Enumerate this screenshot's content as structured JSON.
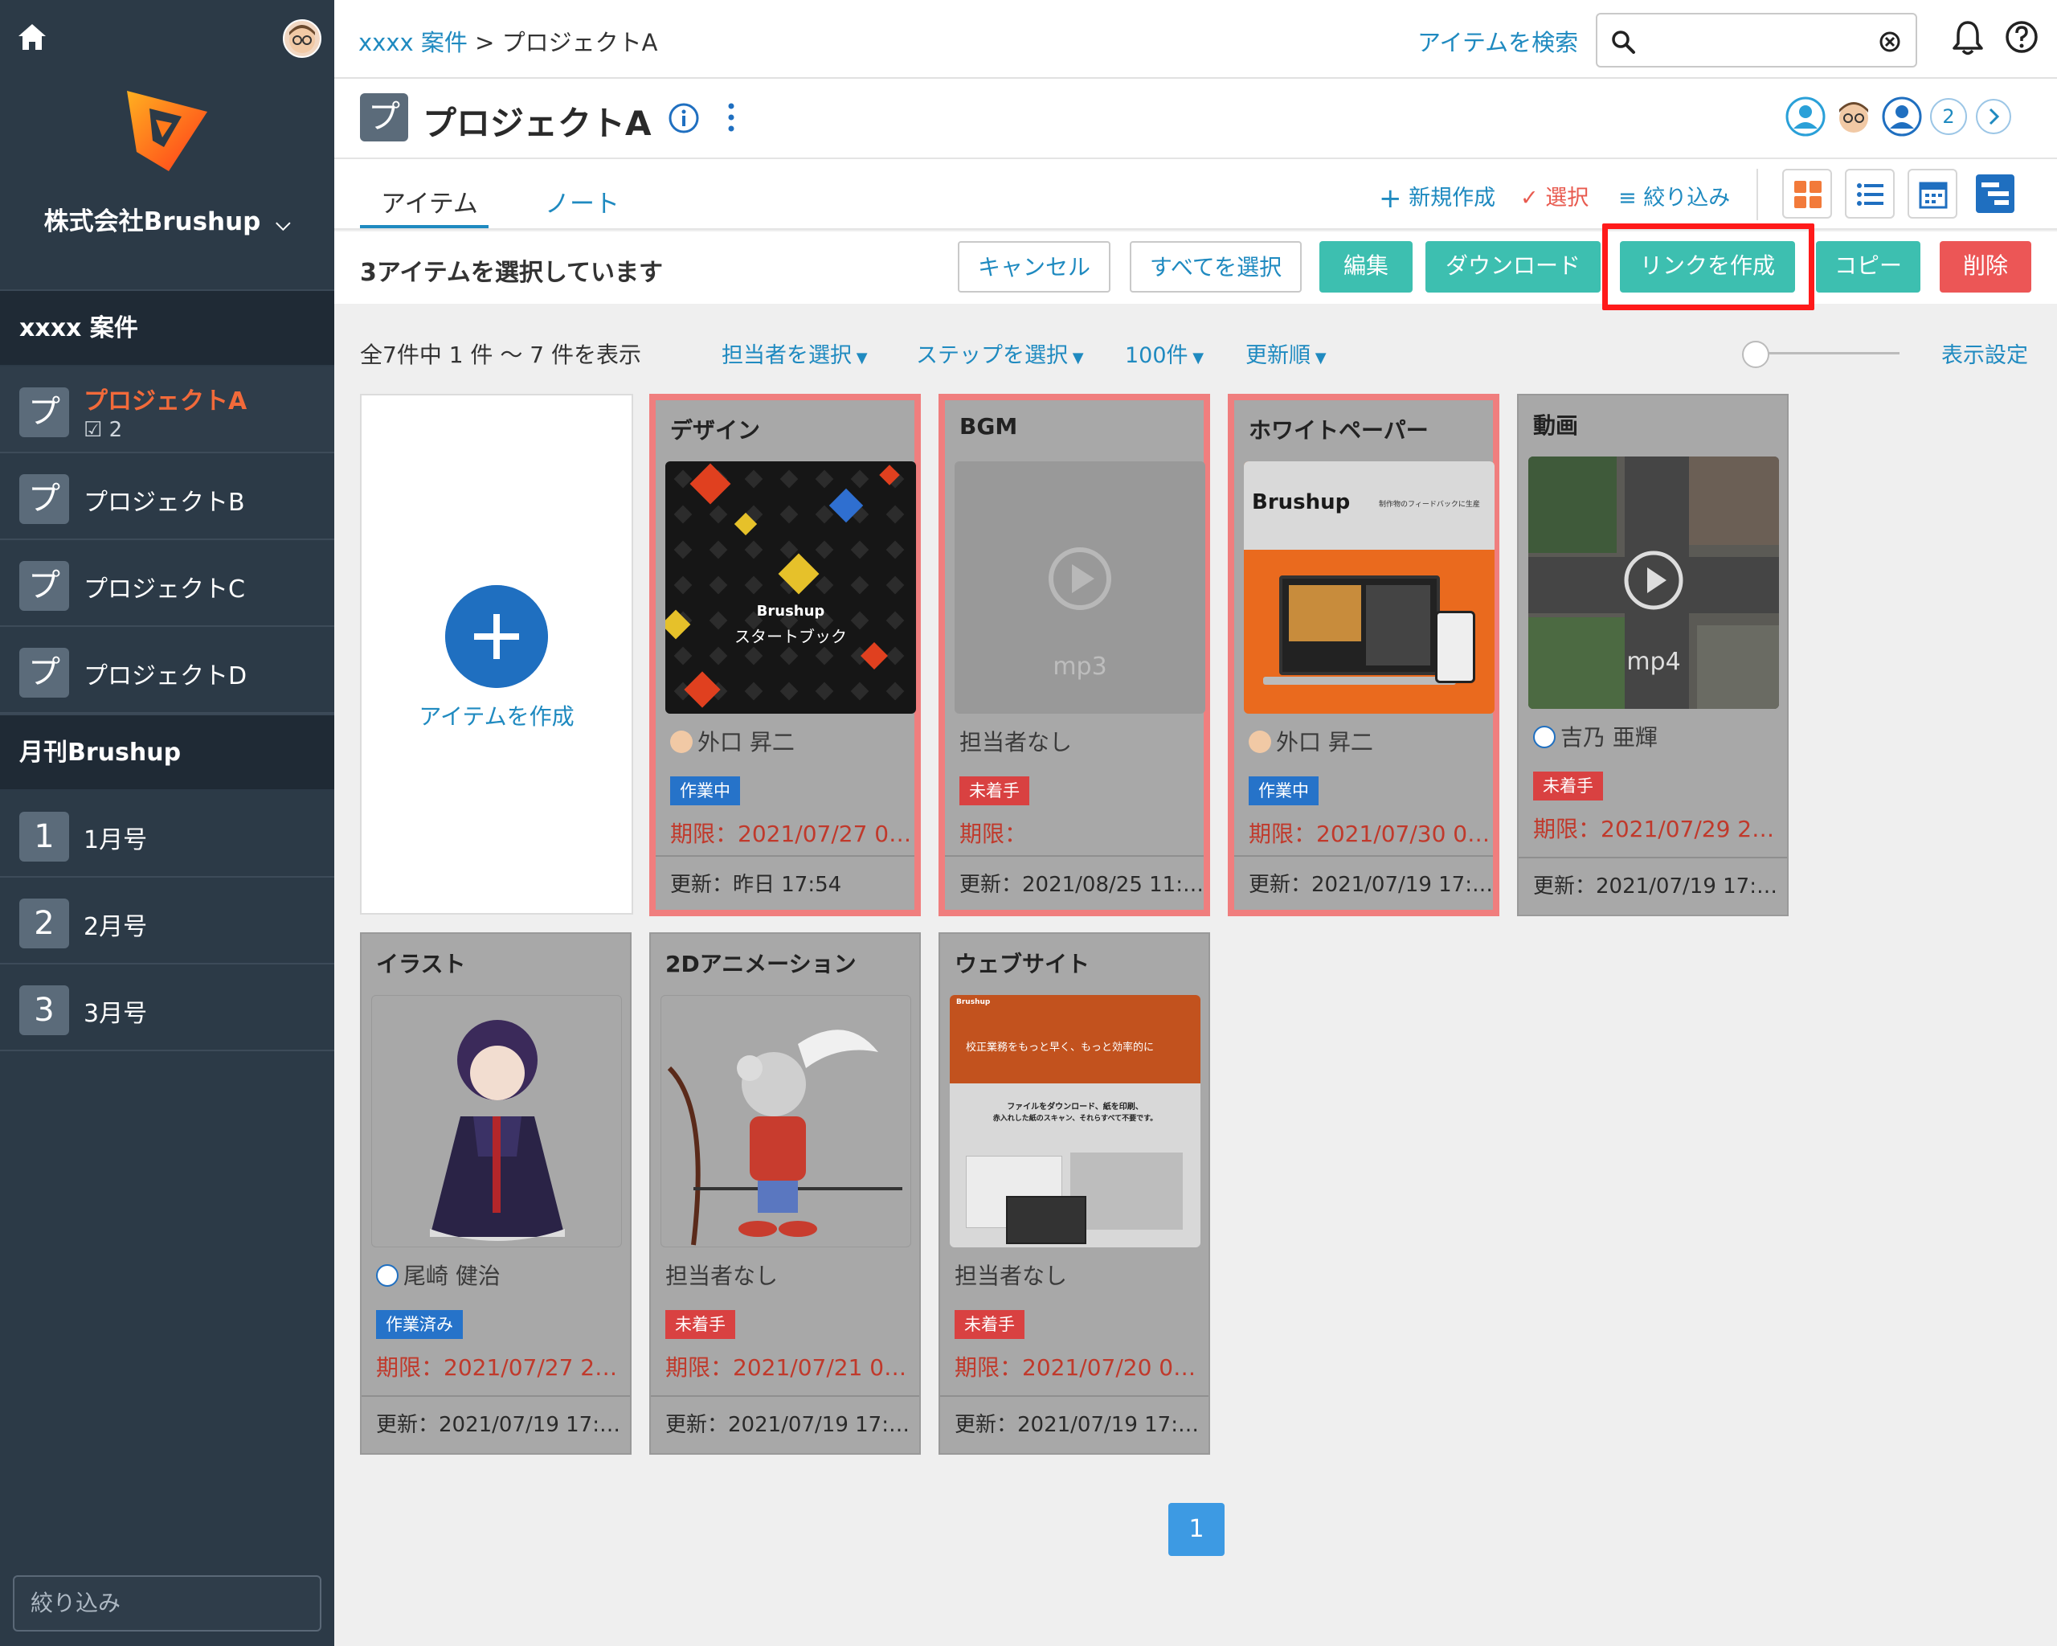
{
  "sidebar": {
    "company": "株式会社Brushup",
    "section1": "xxxx 案件",
    "projects": [
      {
        "badge": "プ",
        "label": "プロジェクトA",
        "sub": "2"
      },
      {
        "badge": "プ",
        "label": "プロジェクトB"
      },
      {
        "badge": "プ",
        "label": "プロジェクトC"
      },
      {
        "badge": "プ",
        "label": "プロジェクトD"
      }
    ],
    "section2": "月刊Brushup",
    "issues": [
      {
        "badge": "1",
        "label": "1月号"
      },
      {
        "badge": "2",
        "label": "2月号"
      },
      {
        "badge": "3",
        "label": "3月号"
      }
    ],
    "filter_placeholder": "絞り込み"
  },
  "topbar": {
    "crumb_parent": "xxxx 案件",
    "crumb_sep": " > ",
    "crumb_current": "プロジェクトA",
    "search_link": "アイテムを検索"
  },
  "project": {
    "badge": "プ",
    "title": "プロジェクトA",
    "member_overflow": "2"
  },
  "tabs": {
    "items": "アイテム",
    "notes": "ノート"
  },
  "toolbar": {
    "new": "新規作成",
    "select": "選択",
    "filter": "絞り込み"
  },
  "selection": {
    "text": "3アイテムを選択しています",
    "cancel": "キャンセル",
    "select_all": "すべてを選択",
    "edit": "編集",
    "download": "ダウンロード",
    "create_link": "リンクを作成",
    "copy": "コピー",
    "delete": "削除"
  },
  "filters": {
    "count": "全7件中 1 件 〜 7 件を表示",
    "assignee": "担当者を選択",
    "step": "ステップを選択",
    "per_page": "100件",
    "sort": "更新順",
    "display_settings": "表示設定"
  },
  "create_item": "アイテムを作成",
  "cards": [
    {
      "title": "デザイン",
      "thumb_line1": "Brushup",
      "thumb_line2": "スタートブック",
      "assignee": "外口 昇二",
      "status": "作業中",
      "due": "期限：2021/07/27 0…",
      "update": "更新：昨日 17:54"
    },
    {
      "title": "BGM",
      "thumb_ext": "mp3",
      "assignee": "担当者なし",
      "status": "未着手",
      "due": "期限：",
      "update": "更新：2021/08/25 11:…"
    },
    {
      "title": "ホワイトペーパー",
      "thumb_brand": "Brushup",
      "thumb_tagline": "制作物のフィードバックに生産",
      "assignee": "外口 昇二",
      "status": "作業中",
      "due": "期限：2021/07/30 0…",
      "update": "更新：2021/07/19 17:…"
    },
    {
      "title": "動画",
      "thumb_ext": "mp4",
      "assignee": "吉乃 亜輝",
      "status": "未着手",
      "due": "期限：2021/07/29 2…",
      "update": "更新：2021/07/19 17:…"
    },
    {
      "title": "イラスト",
      "assignee": "尾崎 健治",
      "status": "作業済み",
      "due": "期限：2021/07/27 2…",
      "update": "更新：2021/07/19 17:…"
    },
    {
      "title": "2Dアニメーション",
      "assignee": "担当者なし",
      "status": "未着手",
      "due": "期限：2021/07/21 0…",
      "update": "更新：2021/07/19 17:…"
    },
    {
      "title": "ウェブサイト",
      "thumb_brand": "Brushup",
      "thumb_headline": "校正業務をもっと早く、もっと効率的に",
      "thumb_body1": "ファイルをダウンロード、紙を印刷、",
      "thumb_body2": "赤入れした紙のスキャン、それらすべて不要です。",
      "assignee": "担当者なし",
      "status": "未着手",
      "due": "期限：2021/07/20 0…",
      "update": "更新：2021/07/19 17:…"
    }
  ],
  "pagination": {
    "current": "1"
  },
  "colors": {
    "sidebar": "#2c3a47",
    "accent_blue": "#1f8ac0",
    "teal": "#3dbfb0",
    "danger": "#ec5656",
    "active_project": "#f26a3a",
    "highlight": "#ff1a1a"
  }
}
